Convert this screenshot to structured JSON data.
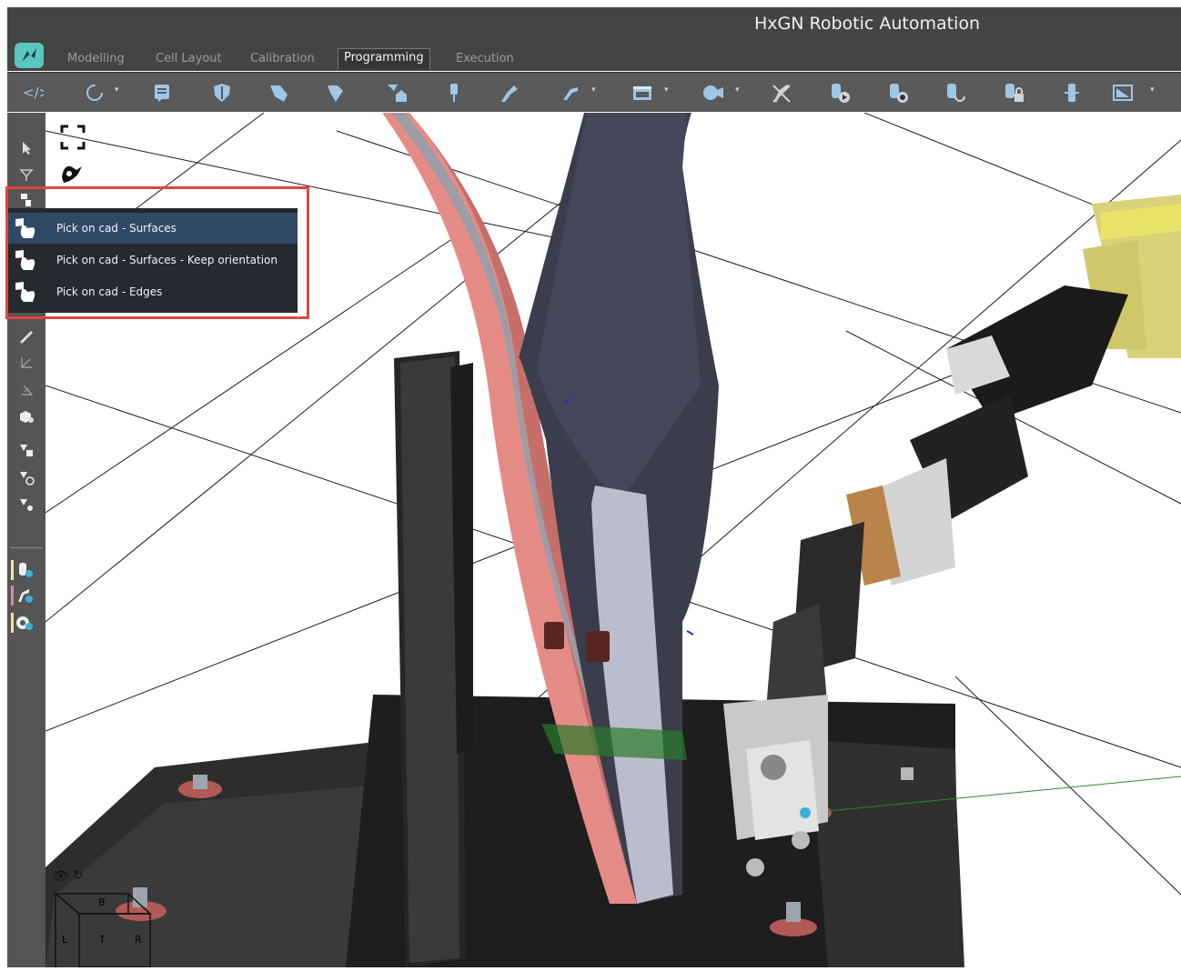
{
  "window": {
    "title": "HxGN Robotic Automation"
  },
  "tabs": [
    {
      "label": "Modelling"
    },
    {
      "label": "Cell Layout"
    },
    {
      "label": "Calibration"
    },
    {
      "label": "Programming"
    },
    {
      "label": "Execution"
    }
  ],
  "active_tab": "Programming",
  "pick_menu": {
    "items": [
      {
        "label": "Pick on cad - Surfaces"
      },
      {
        "label": "Pick on cad - Surfaces - Keep orientation"
      },
      {
        "label": "Pick on cad - Edges"
      }
    ],
    "selected": "Pick on cad - Surfaces"
  },
  "view_cube": {
    "back": "B",
    "left": "L",
    "top": "T",
    "right": "R"
  },
  "colors": {
    "accent": "#58c7bd",
    "highlight_border": "#e0453f",
    "menu_selected": "#2f4967",
    "toolbar_icon": "#9ec6e6"
  }
}
